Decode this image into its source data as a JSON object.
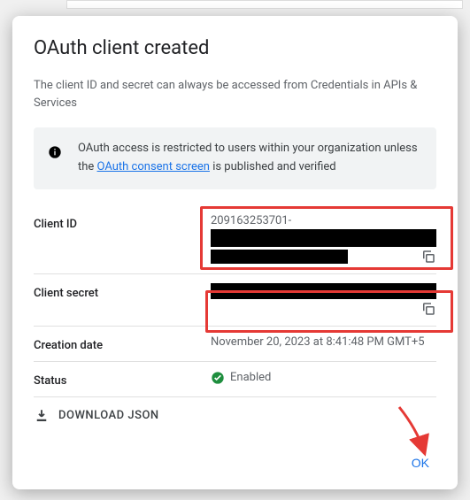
{
  "dialog": {
    "title": "OAuth client created",
    "subtitle": "The client ID and secret can always be accessed from Credentials in APIs & Services",
    "banner": {
      "text_before": "OAuth access is restricted to users within your organization unless the ",
      "link_text": "OAuth consent screen",
      "text_after": " is published and verified"
    },
    "fields": {
      "client_id": {
        "label": "Client ID",
        "value_prefix": "209163253701-"
      },
      "client_secret": {
        "label": "Client secret"
      },
      "creation_date": {
        "label": "Creation date",
        "value": "November 20, 2023 at 8:41:48 PM GMT+5"
      },
      "status": {
        "label": "Status",
        "value": "Enabled"
      }
    },
    "download_label": "DOWNLOAD JSON",
    "ok_label": "OK"
  }
}
